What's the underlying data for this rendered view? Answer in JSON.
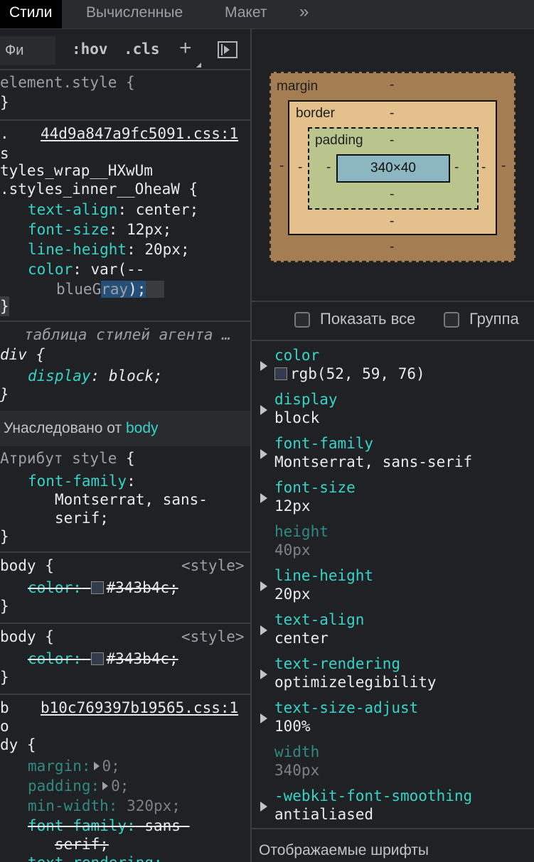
{
  "tabs": {
    "styles": "Стили",
    "computed": "Вычисленные",
    "layout": "Макет",
    "more": "»"
  },
  "toolbar": {
    "filter_placeholder": "Фи",
    "hov": ":hov",
    "cls": ".cls",
    "new_rule": "+"
  },
  "rules": {
    "element_style": {
      "selector": "element.style {",
      "close": "}"
    },
    "rule1": {
      "selector_line1": ".",
      "source": "44d9a847a9fc5091.css:1",
      "selector_line2": "s",
      "selector_line3": "tyles_wrap__HXwUm",
      "selector_line4": ".styles_inner__OheaW {",
      "p1_name": "text-align",
      "p1_value": " center;",
      "p2_name": "font-size",
      "p2_value": " 12px;",
      "p3_name": "line-height",
      "p3_value": " 20px;",
      "p4_name": "color",
      "p4_value": " var(--",
      "p4_cont_a": "blueG",
      "p4_cont_b": "ray",
      "p4_cont_c": ");",
      "close": "}"
    },
    "agent": {
      "title": "таблица стилей агента …",
      "selector": "div {",
      "p_name": "display",
      "p_value": " block;",
      "close": "}"
    },
    "inherited": {
      "label": "Унаследовано от ",
      "tag": "body"
    },
    "attr_style": {
      "selector_a": "Атрибут style",
      "selector_b": " {",
      "p_name": "font-family",
      "p_value1": "Montserrat, sans-",
      "p_value2": "serif;",
      "close": "}"
    },
    "body1": {
      "selector": "body {",
      "source": "<style>",
      "p_name": "color:",
      "p_value": "#343b4c;",
      "swatch": "#343b4c",
      "close": "}"
    },
    "body2": {
      "selector": "body {",
      "source": "<style>",
      "p_name": "color:",
      "p_value": "#343b4c;",
      "swatch": "#343b4c",
      "close": "}"
    },
    "body3": {
      "selector_line1": "b",
      "source": "b10c769397b19565.css:1",
      "selector_line2": "o",
      "selector_line3": "dy {",
      "p1_name": "margin:",
      "p1_value": "0;",
      "p2_name": "padding:",
      "p2_value": "0;",
      "p3_name": "min-width:",
      "p3_value": " 320px;",
      "p4_name": "font-family:",
      "p4_value": " sans-",
      "p4_cont": "serif;",
      "p5_name": "text-rendering:"
    }
  },
  "box_model": {
    "margin_label": "margin",
    "border_label": "border",
    "padding_label": "padding",
    "dash": "-",
    "content": "340×40"
  },
  "computed": {
    "show_all": "Показать все",
    "group": "Группа",
    "items": [
      {
        "name": "color",
        "value": "rgb(52, 59, 76)",
        "swatch": "#343b4c"
      },
      {
        "name": "display",
        "value": "block"
      },
      {
        "name": "font-family",
        "value": "Montserrat, sans-serif"
      },
      {
        "name": "font-size",
        "value": "12px"
      },
      {
        "name": "height",
        "value": "40px"
      },
      {
        "name": "line-height",
        "value": "20px"
      },
      {
        "name": "text-align",
        "value": "center"
      },
      {
        "name": "text-rendering",
        "value": "optimizelegibility"
      },
      {
        "name": "text-size-adjust",
        "value": "100%"
      },
      {
        "name": "width",
        "value": "340px"
      },
      {
        "name": "-webkit-font-smoothing",
        "value": "antialiased"
      }
    ],
    "rendered_fonts": "Отображаемые шрифты"
  }
}
